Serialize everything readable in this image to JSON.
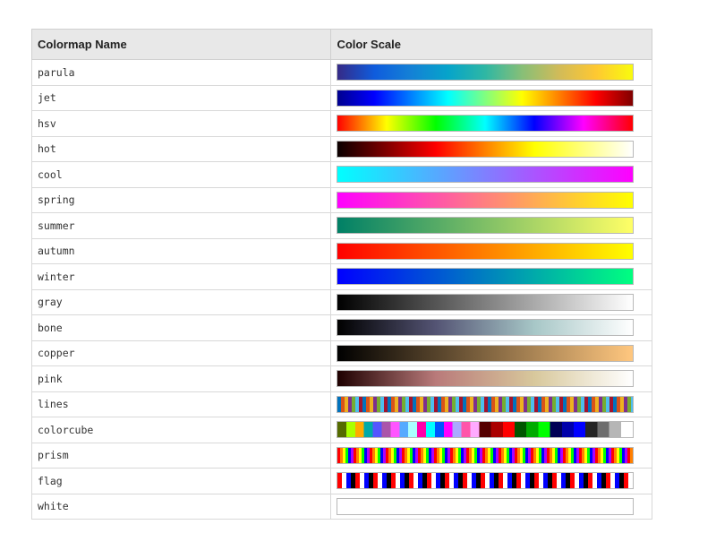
{
  "table": {
    "headers": {
      "name": "Colormap Name",
      "scale": "Color Scale"
    },
    "rows": [
      {
        "name": "parula",
        "gradient": "linear-gradient(to right,#352a87,#0f5cdd,#1481d6,#06a4ca,#2eb7a4,#87bf77,#d1bb59,#fec832,#f9fb0e)"
      },
      {
        "name": "jet",
        "gradient": "linear-gradient(to right,#00008f,#0000ff,#0080ff,#00ffff,#80ff80,#ffff00,#ff8000,#ff0000,#800000)"
      },
      {
        "name": "hsv",
        "gradient": "linear-gradient(to right,#ff0000,#ffff00,#00ff00,#00ffff,#0000ff,#ff00ff,#ff0000)"
      },
      {
        "name": "hot",
        "gradient": "linear-gradient(to right,#0b0000,#800000,#ff0000,#ff8000,#ffff00,#ffff80,#ffffff)"
      },
      {
        "name": "cool",
        "gradient": "linear-gradient(to right,#00ffff,#ff00ff)"
      },
      {
        "name": "spring",
        "gradient": "linear-gradient(to right,#ff00ff,#ffff00)"
      },
      {
        "name": "summer",
        "gradient": "linear-gradient(to right,#008066,#ffff66)"
      },
      {
        "name": "autumn",
        "gradient": "linear-gradient(to right,#ff0000,#ffff00)"
      },
      {
        "name": "winter",
        "gradient": "linear-gradient(to right,#0000ff,#00ff80)"
      },
      {
        "name": "gray",
        "gradient": "linear-gradient(to right,#000000,#ffffff)"
      },
      {
        "name": "bone",
        "gradient": "linear-gradient(to right,#000000,#545474,#a7c7c7,#ffffff)"
      },
      {
        "name": "copper",
        "gradient": "linear-gradient(to right,#000000,#ffc77f)"
      },
      {
        "name": "pink",
        "gradient": "linear-gradient(to right,#1e0000,#b97a7a,#d8c89c,#ffffff)"
      },
      {
        "name": "lines",
        "gradient": "repeating-linear-gradient(to right,#0072bd 0 4px,#d95319 4px 8px,#edb120 8px 12px,#7e2f8e 12px 16px,#77ac30 16px 20px,#4dbeee 20px 24px,#a2142f 24px 28px)"
      },
      {
        "name": "colorcube",
        "gradient": "linear-gradient(to right,#556b00 0 3%,#aaff00 3% 6%,#ffaa00 6% 9%,#00aaaa 9% 12%,#5555ff 12% 15%,#aa55aa 15% 18%,#ff55ff 18% 21%,#55aaff 21% 24%,#aaffff 24% 27%,#ff00aa 27% 30%,#00ffff 30% 33%,#0055ff 33% 36%,#ff00ff 36% 39%,#aaaaff 39% 42%,#ff55aa 42% 45%,#ffaaff 45% 48%,#550000 48% 52%,#aa0000 52% 56%,#ff0000 56% 60%,#005500 60% 64%,#00aa00 64% 68%,#00ff00 68% 72%,#000055 72% 76%,#0000aa 76% 80%,#0000ff 80% 84%,#242424 84% 88%,#6d6d6d 88% 92%,#b6b6b6 92% 96%,#ffffff 96% 100%)"
      },
      {
        "name": "prism",
        "gradient": "repeating-linear-gradient(to right,#ff0000 0 3px,#ff8000 3px 6px,#ffff00 6px 9px,#00ff00 9px 12px,#0000ff 12px 15px,#aa00ff 15px 18px)"
      },
      {
        "name": "flag",
        "gradient": "repeating-linear-gradient(to right,#ff0000 0 5px,#ffffff 5px 10px,#0000ff 10px 15px,#000000 15px 20px)"
      },
      {
        "name": "white",
        "gradient": "linear-gradient(to right,#ffffff,#ffffff)"
      }
    ]
  }
}
